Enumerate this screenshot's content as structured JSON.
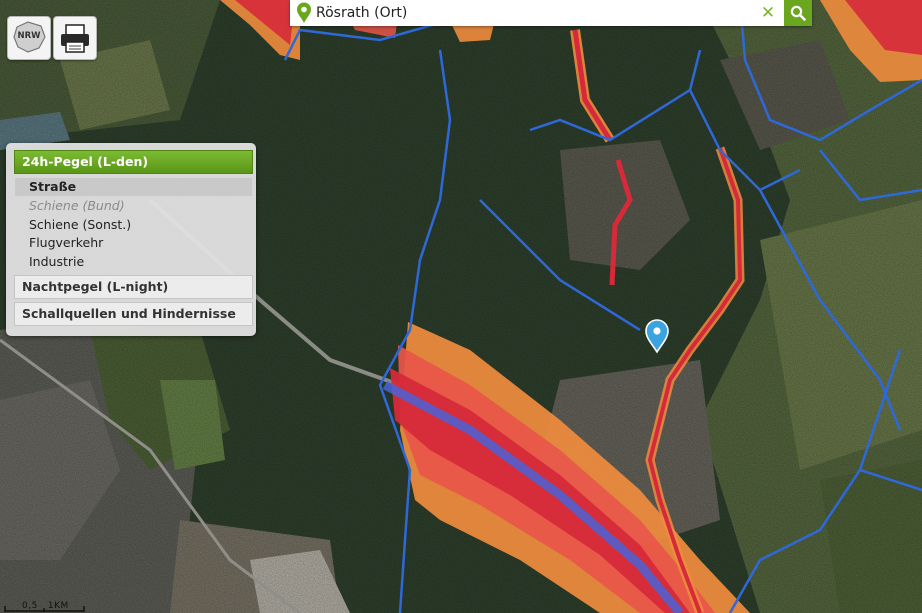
{
  "search": {
    "value": "Rösrath (Ort)",
    "clear_symbol": "✕"
  },
  "tools": {
    "region_badge": "NRW"
  },
  "layer_panel": {
    "day_group": {
      "label": "24h-Pegel (L-den)",
      "items": [
        {
          "label": "Straße",
          "state": "active"
        },
        {
          "label": "Schiene (Bund)",
          "state": "disabled"
        },
        {
          "label": "Schiene (Sonst.)",
          "state": "normal"
        },
        {
          "label": "Flugverkehr",
          "state": "normal"
        },
        {
          "label": "Industrie",
          "state": "normal"
        }
      ]
    },
    "night_group": {
      "label": "Nachtpegel (L-night)"
    },
    "sources_group": {
      "label": "Schallquellen und Hindernisse"
    }
  },
  "scale": {
    "label": "0,5   1KM"
  },
  "colors": {
    "accent": "#6aa61e",
    "noise_high": "#d62a3a",
    "noise_mid": "#e8564a",
    "noise_low": "#f08c3e",
    "water": "#2f68d8",
    "marker": "#3aa3e0"
  },
  "icons": {
    "search_pin": "location-pin-icon",
    "search_go": "magnifier-icon",
    "print": "printer-icon",
    "region": "nrw-map-icon",
    "marker": "map-marker-icon"
  }
}
